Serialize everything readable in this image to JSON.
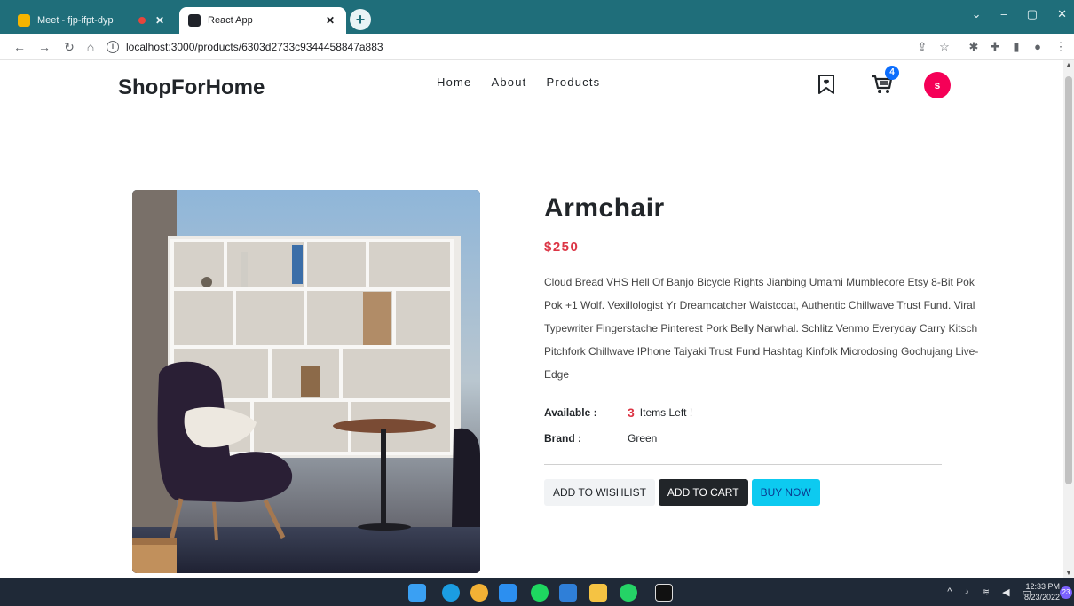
{
  "browser": {
    "tabs": [
      {
        "title": "Meet - fjp-ifpt-dyp",
        "active": false
      },
      {
        "title": "React App",
        "active": true
      }
    ],
    "url": "localhost:3000/products/6303d2733c9344458847a883"
  },
  "navbar": {
    "brand": "ShopForHome",
    "links": [
      "Home",
      "About",
      "Products"
    ],
    "cart_count": "4",
    "avatar_initial": "s"
  },
  "product": {
    "title": "Armchair",
    "price": "$250",
    "description": "Cloud Bread VHS Hell Of Banjo Bicycle Rights Jianbing Umami Mumblecore Etsy 8-Bit Pok Pok +1 Wolf. Vexillologist Yr Dreamcatcher Waistcoat, Authentic Chillwave Trust Fund. Viral Typewriter Fingerstache Pinterest Pork Belly Narwhal. Schlitz Venmo Everyday Carry Kitsch Pitchfork Chillwave IPhone Taiyaki Trust Fund Hashtag Kinfolk Microdosing Gochujang Live-Edge",
    "available_label": "Available :",
    "available_count": "3",
    "available_suffix": "Items Left !",
    "brand_label": "Brand :",
    "brand_value": "Green"
  },
  "actions": {
    "wishlist": "ADD TO WISHLIST",
    "cart": "ADD TO CART",
    "buy": "BUY NOW"
  },
  "taskbar": {
    "time": "12:33 PM",
    "date": "8/23/2022",
    "notifications": "23"
  },
  "colors": {
    "chrome": "#1f6e7a",
    "price": "#dc3545",
    "avatar": "#f50057",
    "buy": "#0dcaf0"
  }
}
